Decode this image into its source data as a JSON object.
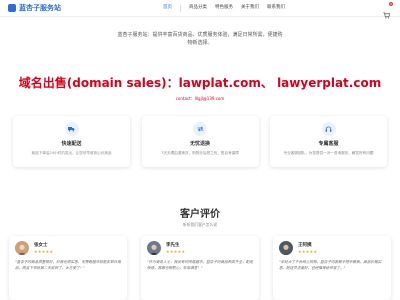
{
  "header": {
    "logo_text": "蓝杏子服务站",
    "nav": [
      "首页",
      "商品分类",
      "特色服务",
      "关于我们",
      "联系我们"
    ],
    "active_index": 0,
    "cart_count": "0",
    "brand_color": "#2b6fd6"
  },
  "hero": {
    "line1": "蓝杏子服务站：提供丰富百货商品、优质服务体验，满足日常所需，便捷购",
    "line2": "物新选择。",
    "domain_sale": "域名出售(domain sales)：lawplat.com、 lawyerplat.com",
    "contact": "contact：lllgjl@139.com",
    "sale_color": "#d9001b"
  },
  "features": [
    {
      "icon": "truck-icon",
      "title": "快速配送",
      "desc": "商品下单后24小时内发出，让您尽早收到心仪商品"
    },
    {
      "icon": "exchange-icon",
      "title": "无忧退换",
      "desc": "7天无理由退换货，购物无后顾之忧，售后有保障"
    },
    {
      "icon": "headset-icon",
      "title": "专属客服",
      "desc": "专业客服团队，为您提供一对一咨询服务，解答所有问题"
    }
  ],
  "reviews": {
    "title": "客户评价",
    "subtitle": "听听我们客户怎么说",
    "items": [
      {
        "name": "张女士",
        "stars": "★★★★★",
        "text": "\"蓝杏子的商品质量很好，价格也很实惠，无需跑超市就能买到日用品，而且下单后第二天就到了，太方便了！\""
      },
      {
        "name": "李先生",
        "stars": "★★★★★",
        "text": "\"作为商务人士，我没有时间逛超市，蓝杏子的商品种类齐全，配送快速，客服也很耐心，非常满意！\""
      },
      {
        "name": "王阿姨",
        "stars": "★★★★★",
        "text": "\"年纪大了不会网上购物，蓝杏子的客服手把手教我，商品价格实惠，配送员态度好，已经推荐给邻居了。\""
      }
    ]
  }
}
